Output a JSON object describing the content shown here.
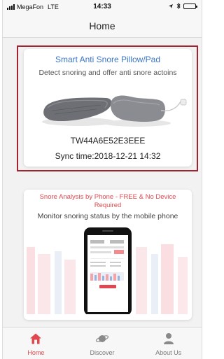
{
  "status_bar": {
    "carrier": "MegaFon",
    "network": "LTE",
    "time": "14:33"
  },
  "nav": {
    "title": "Home"
  },
  "device_card": {
    "title": "Smart Anti Snore Pillow/Pad",
    "subtitle": "Detect snoring and offer anti snore actoins",
    "device_id": "TW44A6E52E3EEE",
    "sync_label": "Sync time:",
    "sync_time": "2018-12-21 14:32"
  },
  "analysis_card": {
    "promo": "Snore Analysis by Phone - FREE & No Device Required",
    "description": "Monitor snoring status by the mobile phone"
  },
  "tabs": [
    {
      "label": "Home",
      "icon": "home-icon",
      "active": true
    },
    {
      "label": "Discover",
      "icon": "planet-icon",
      "active": false
    },
    {
      "label": "About Us",
      "icon": "person-icon",
      "active": false
    }
  ],
  "colors": {
    "accent_red": "#e0484f",
    "title_blue": "#3a76c4",
    "outline": "#a3222f"
  }
}
